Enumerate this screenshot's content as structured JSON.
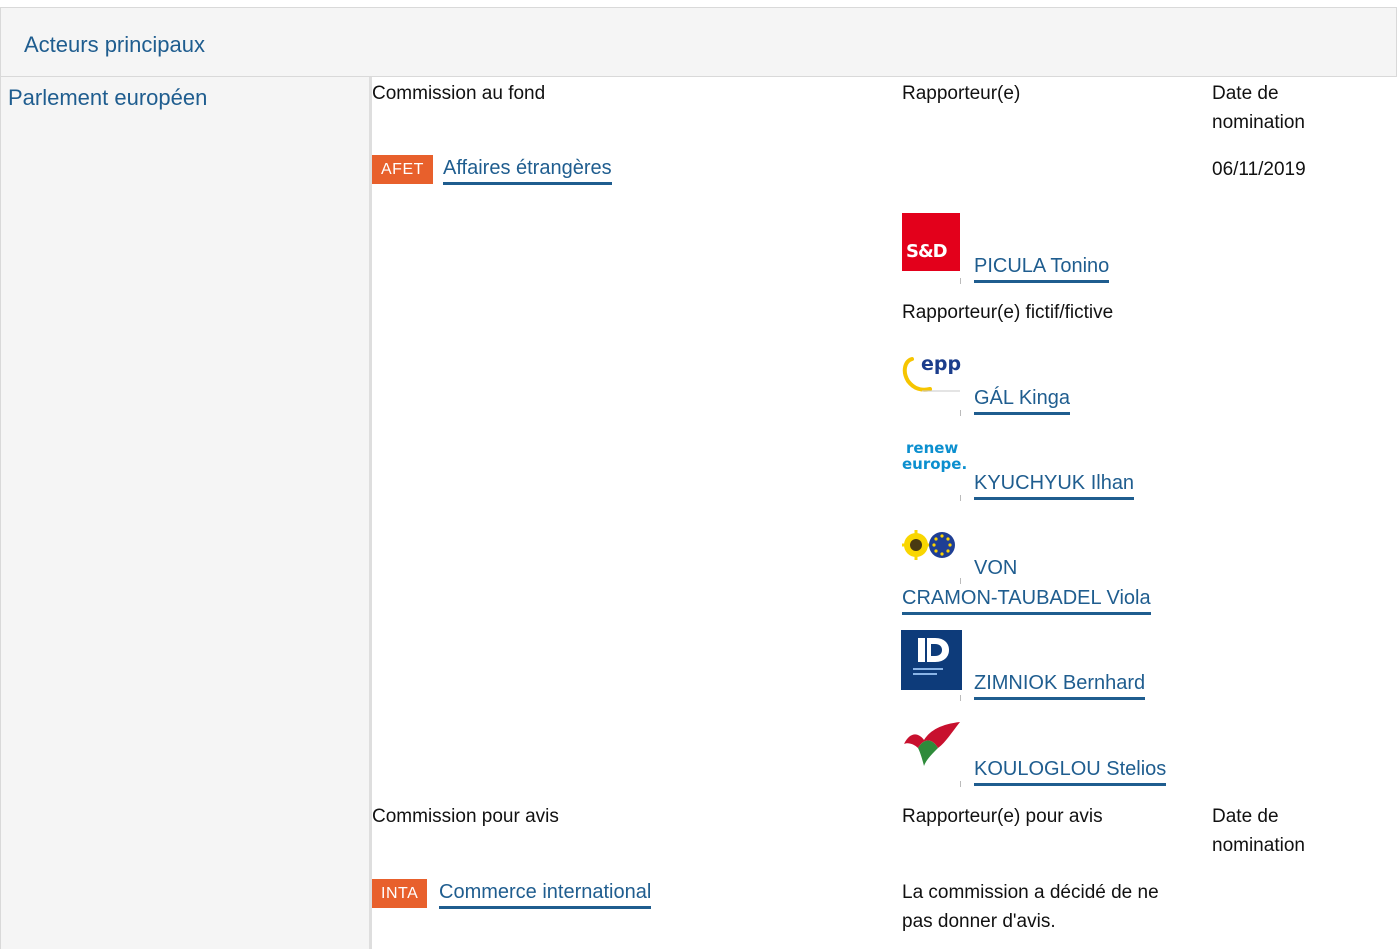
{
  "header": {
    "title": "Acteurs principaux"
  },
  "left": {
    "institution": "Parlement européen"
  },
  "fond": {
    "col_commission": "Commission au fond",
    "col_rapporteur": "Rapporteur(e)",
    "col_date_line1": "Date de",
    "col_date_line2": "nomination",
    "committee_code": "AFET",
    "committee_name": "Affaires étrangères",
    "date": "06/11/2019",
    "rapporteur": {
      "name": "PICULA Tonino",
      "group_logo": "s-and-d-logo"
    },
    "shadow_label": "Rapporteur(e) fictif/fictive",
    "shadows": [
      {
        "name": "GÁL Kinga",
        "group_logo": "epp-logo"
      },
      {
        "name": "KYUCHYUK Ilhan",
        "group_logo": "renew-europe-logo"
      },
      {
        "name_line1": "VON",
        "name_line2": "CRAMON-TAUBADEL Viola",
        "group_logo": "greens-efa-logo"
      },
      {
        "name": "ZIMNIOK Bernhard",
        "group_logo": "id-logo"
      },
      {
        "name": "KOULOGLOU Stelios",
        "group_logo": "gue-ngl-logo"
      }
    ],
    "logos": {
      "sd_text": "S&D",
      "epp_text": "epp",
      "renew_line1": "renew",
      "renew_line2": "europe."
    }
  },
  "avis": {
    "col_commission": "Commission pour avis",
    "col_rapporteur": "Rapporteur(e) pour avis",
    "col_date_line1": "Date de",
    "col_date_line2": "nomination",
    "committee_code": "INTA",
    "committee_name": "Commerce international",
    "note_line1": "La commission a décidé de ne",
    "note_line2": "pas donner d'avis."
  },
  "colors": {
    "link": "#1f5d8f",
    "badge": "#e8602c",
    "panel": "#f5f5f5",
    "sd_red": "#e3001b",
    "id_blue": "#0d3b7a"
  }
}
